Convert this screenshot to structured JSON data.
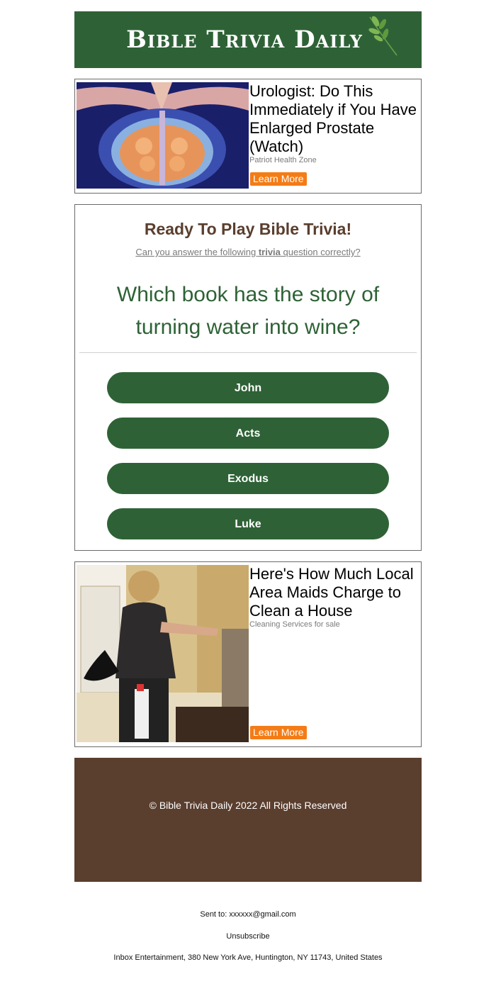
{
  "header": {
    "logo_text": "Bible Trivia Daily"
  },
  "ad1": {
    "title": "Urologist: Do This Immediately if You Have Enlarged Prostate (Watch)",
    "source": "Patriot Health Zone",
    "button": "Learn More"
  },
  "quiz": {
    "heading": "Ready To Play Bible Trivia!",
    "sub_prefix": "Can you answer the following ",
    "sub_bold": "trivia",
    "sub_suffix": " question correctly?",
    "question": "Which book has the story of turning water into wine?",
    "answers": [
      "John",
      "Acts",
      "Exodus",
      "Luke"
    ]
  },
  "ad2": {
    "title": "Here's How Much Local Area Maids Charge to Clean a House",
    "source": "Cleaning Services for sale",
    "button": "Learn More"
  },
  "footer": {
    "copyright": "© Bible Trivia Daily 2022 All Rights Reserved"
  },
  "meta": {
    "sent_to": "Sent to: xxxxxx@gmail.com",
    "unsubscribe": "Unsubscribe",
    "address": "Inbox Entertainment, 380 New York Ave, Huntington, NY 11743, United States"
  },
  "colors": {
    "brand_green": "#2e6236",
    "brown": "#5a3e2e",
    "cta_orange": "#f47c16"
  }
}
